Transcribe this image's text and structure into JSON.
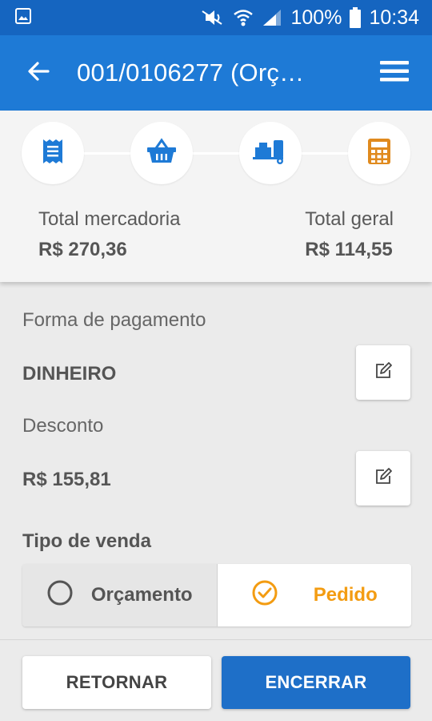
{
  "status_bar": {
    "battery_percent": "100%",
    "time": "10:34",
    "icons": [
      "gallery-icon",
      "mute-icon",
      "wifi-icon",
      "signal-icon",
      "battery-icon"
    ]
  },
  "app_bar": {
    "title": "001/0106277 (Orç…",
    "back_icon": "arrow-left-icon",
    "menu_icon": "hamburger-menu-icon"
  },
  "stepper": {
    "steps": [
      {
        "icon": "receipt-icon",
        "color": "#1e7ad6"
      },
      {
        "icon": "basket-icon",
        "color": "#1e7ad6"
      },
      {
        "icon": "delivery-truck-icon",
        "color": "#1e7ad6"
      },
      {
        "icon": "calculator-icon",
        "color": "#e08a1e"
      }
    ]
  },
  "totals": {
    "merchandise_label": "Total mercadoria",
    "merchandise_value": "R$ 270,36",
    "grand_label": "Total geral",
    "grand_value": "R$ 114,55"
  },
  "payment": {
    "label": "Forma de pagamento",
    "value": "DINHEIRO"
  },
  "discount": {
    "label": "Desconto",
    "value": "R$ 155,81"
  },
  "sale_type": {
    "title": "Tipo de venda",
    "options": [
      {
        "label": "Orçamento",
        "selected": false
      },
      {
        "label": "Pedido",
        "selected": true
      }
    ]
  },
  "footer": {
    "return_label": "RETORNAR",
    "close_label": "ENCERRAR"
  },
  "colors": {
    "status_bar": "#1565c0",
    "app_bar": "#1e7ad6",
    "accent_orange": "#f39c12",
    "primary_button": "#1e6fc8"
  }
}
